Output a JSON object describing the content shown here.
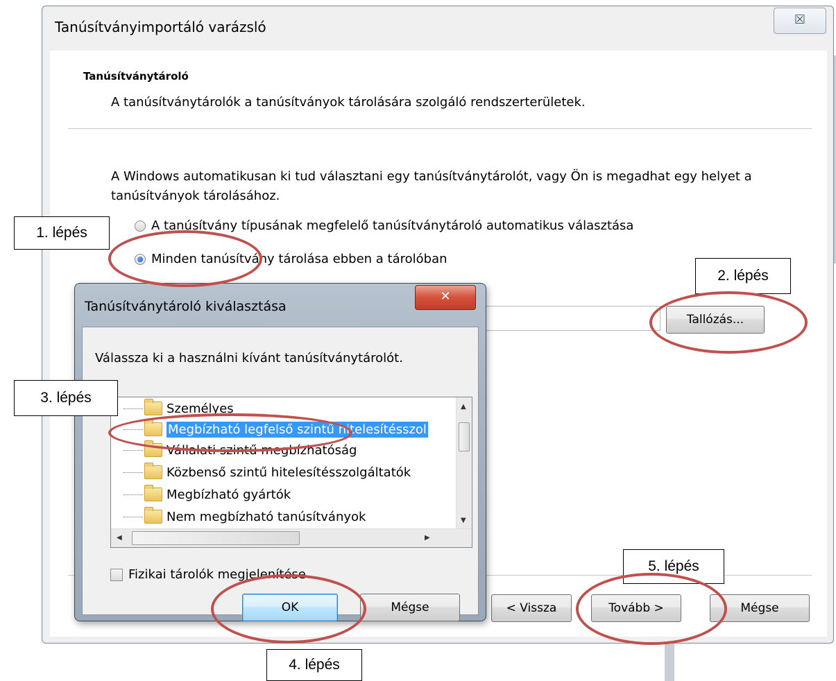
{
  "wizard": {
    "title": "Tanúsítványimportáló varázsló",
    "close_glyph": "☒",
    "section_title": "Tanúsítványtároló",
    "section_desc": "A tanúsítványtárolók a tanúsítványok tárolására szolgáló rendszerterületek.",
    "intro": "A Windows automatikusan ki tud választani egy tanúsítványtárolót, vagy Ön is megadhat egy helyet a tanúsítványok tárolásához.",
    "radio_auto_label": "A tanúsítvány típusának megfelelő tanúsítványtároló automatikus választása",
    "radio_manual_label": "Minden tanúsítvány tárolása ebben a tárolóban",
    "browse_label": "Tallózás...",
    "back_label": "< Vissza",
    "next_label": "Tovább >",
    "cancel_label": "Mégse"
  },
  "select_dialog": {
    "title": "Tanúsítványtároló kiválasztása",
    "close_glyph": "✕",
    "prompt": "Válassza ki a használni kívánt tanúsítványtárolót.",
    "stores": [
      "Személyes",
      "Megbízható legfelső szintű hitelesítésszolgáltatók",
      "Vállalati szintű megbízhatóság",
      "Közbenső szintű hitelesítésszolgáltatók",
      "Megbízható gyártók",
      "Nem megbízható tanúsítványok"
    ],
    "selected_store": "Megbízható legfelső szintű hitelesítésszol",
    "show_physical_label": "Fizikai tárolók megjelenítése",
    "ok_label": "OK",
    "cancel_label": "Mégse"
  },
  "annotations": {
    "step1": "1. lépés",
    "step2": "2. lépés",
    "step3": "3. lépés",
    "step4": "4. lépés",
    "step5": "5. lépés",
    "ring_color": "#c0504d"
  }
}
